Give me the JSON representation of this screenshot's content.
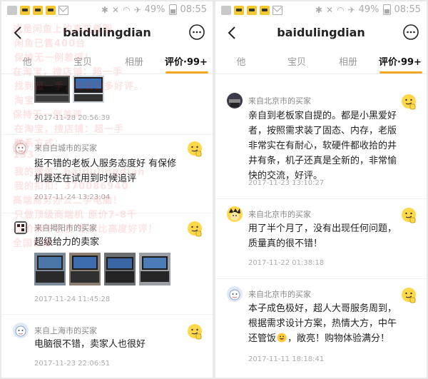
{
  "status_bar": {
    "battery_text": "49%",
    "time": "08:55"
  },
  "shop_name": "baidulingdian",
  "left_panel": {
    "tabs": [
      "他",
      "宝贝",
      "相册",
      "评价·99+"
    ],
    "active_tab": "评价·99+",
    "top_time": "2017-11-28 20:56:39",
    "reviews": [
      {
        "location": "来自白城市的买家",
        "text": "挺不错的老板人服务态度好 有保修 机器还在试用到时候追评",
        "time": "2017-11-24 13:23:04"
      },
      {
        "location": "来自揭阳市的买家",
        "text": "超级给力的卖家",
        "time": "2017-11-24 11:45:28",
        "photo_count": 4
      },
      {
        "location": "来自上海市的买家",
        "text": "电脑很不错，卖家人也很好",
        "time": "2017-11-23 22:06:51"
      }
    ],
    "watermark_lines": [
      "这是闲鱼上的真实截图",
      "闲鱼已售400台",
      "保持无一例差评！",
      "在淘宝，搜店铺：超一手",
      "找到超一手，查看更多好评。",
      "淘宝",
      "保持无一例差评",
      "在淘宝，搜店铺：超一手",
      "联系方式：",
      "133",
      "我的微信：baidulingdian",
      "我的扣扣：370086940",
      "高端商务办公二手电脑！",
      "只做顶级商端机 原价7-8千",
      "现价两千左右 性价比高度好评！",
      "全国包邮"
    ]
  },
  "right_panel": {
    "tabs": [
      "他",
      "宝贝",
      "相册",
      "评价·99+"
    ],
    "active_tab": "评价·99+",
    "reviews": [
      {
        "location": "来自北京市的买家",
        "text": "亲自到老板家自提的。都是小黑爱好者，按照需求装了固态、内存，老版非常实在有耐心，软硬件都收拾的井井有条，机子还真是全新的，非常愉快的交流，好评。",
        "time": "2017-11-23 13:10:27"
      },
      {
        "location": "来自北京市的买家",
        "text": "用了半个月了，没有出现任何问题，质量真的很不错！",
        "time": "2017-11-22 01:38:18"
      },
      {
        "location": "来自北京市的买家",
        "text": "本子成色极好，超人大哥服务周到，根据需求设计方案，热情大方，中午还管饭",
        "text_tail": "，敞亮！购物体验满分！",
        "time": "2017-11-11 18:18:41"
      }
    ]
  },
  "colors": {
    "accent": "#f5a623",
    "watermark": "#e83c3c",
    "text": "#222222",
    "muted": "#888888"
  },
  "icons": [
    "back-arrow-icon",
    "more-icon",
    "thumbs-up-emoji-icon",
    "grin-emoji-icon"
  ]
}
